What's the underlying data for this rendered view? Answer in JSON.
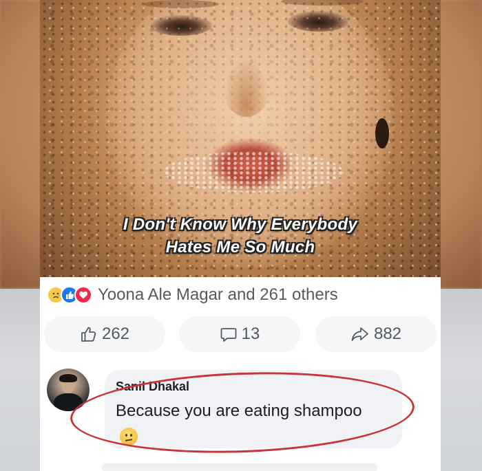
{
  "post": {
    "caption_line1": "I Don't Know Why Everybody",
    "caption_line2": "Hates Me So Much",
    "reactions_summary": "Yoona Ale Magar and 261 others",
    "reaction_icons": [
      "sad-reaction-icon",
      "like-reaction-icon",
      "love-reaction-icon"
    ]
  },
  "actions": {
    "like_count": "262",
    "comment_count": "13",
    "share_count": "882"
  },
  "comment": {
    "author": "Sanil Dhakal",
    "text": "Because you are eating shampoo",
    "emoji": "confused-face-emoji",
    "highlight_color": "#c8343a"
  },
  "colors": {
    "accent_blue": "#1877f2",
    "love_red": "#f02849",
    "text_gray": "#555a60"
  }
}
